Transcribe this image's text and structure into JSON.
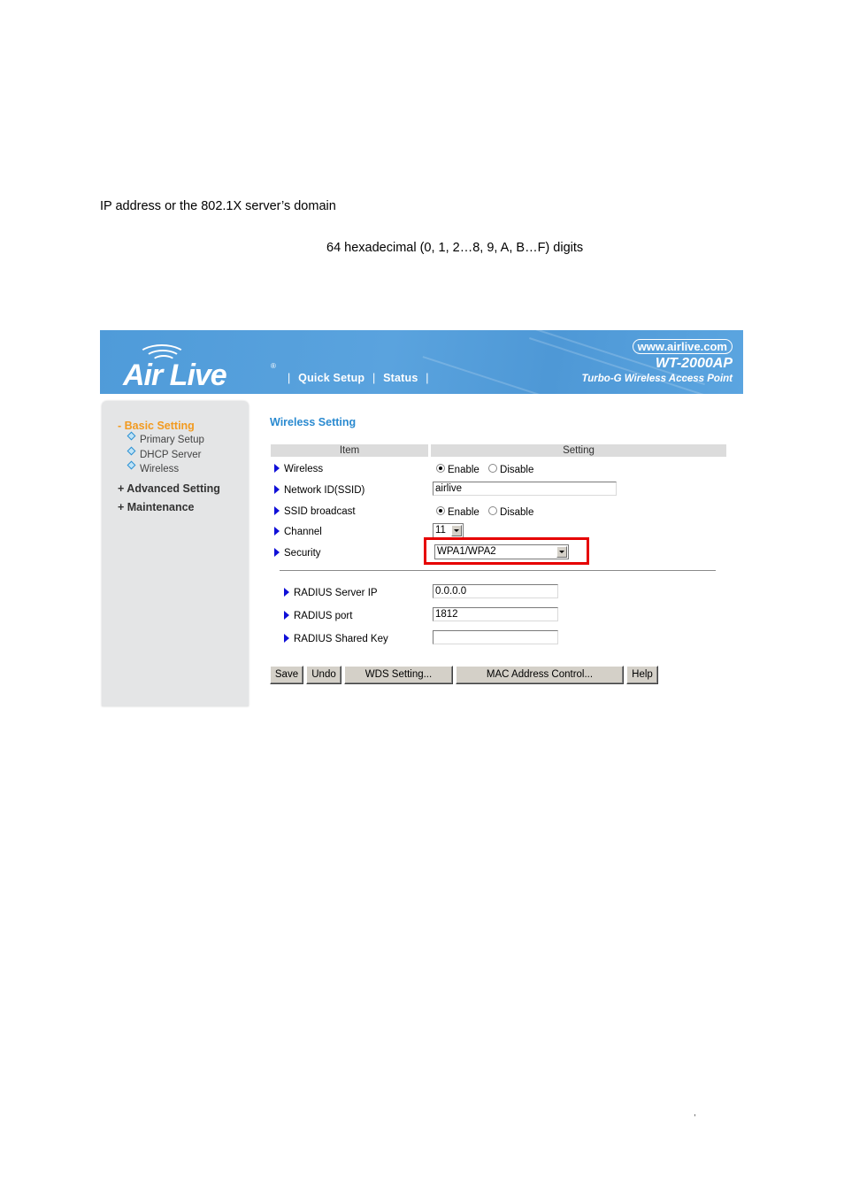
{
  "document": {
    "line1": "IP address or the 802.1X server’s domain",
    "line2": "64 hexadecimal (0, 1, 2…8, 9, A, B…F) digits",
    "stray_mark": ","
  },
  "banner": {
    "logo_text": "Air Live",
    "logo_reg": "®",
    "nav": {
      "sep": "|",
      "quick_setup": "Quick Setup",
      "status": "Status"
    },
    "url": "www.airlive.com",
    "model": "WT-2000AP",
    "tagline": "Turbo-G Wireless Access Point"
  },
  "sidebar": {
    "basic_setting": "- Basic Setting",
    "sub_items": [
      {
        "label": "Primary Setup"
      },
      {
        "label": "DHCP Server"
      },
      {
        "label": "Wireless"
      }
    ],
    "advanced_setting": "+ Advanced Setting",
    "maintenance": "+ Maintenance"
  },
  "content": {
    "title": "Wireless Setting",
    "table_headers": {
      "item": "Item",
      "setting": "Setting"
    },
    "rows": {
      "wireless": {
        "label": "Wireless",
        "options": [
          "Enable",
          "Disable"
        ],
        "selected": "Enable"
      },
      "ssid": {
        "label": "Network ID(SSID)",
        "value": "airlive"
      },
      "ssid_broadcast": {
        "label": "SSID broadcast",
        "options": [
          "Enable",
          "Disable"
        ],
        "selected": "Enable"
      },
      "channel": {
        "label": "Channel",
        "value": "11"
      },
      "security": {
        "label": "Security",
        "value": "WPA1/WPA2"
      }
    },
    "radius": {
      "server_ip": {
        "label": "RADIUS Server IP",
        "value": "0.0.0.0"
      },
      "port": {
        "label": "RADIUS port",
        "value": "1812"
      },
      "shared_key": {
        "label": "RADIUS Shared Key",
        "value": ""
      }
    },
    "buttons": {
      "save": "Save",
      "undo": "Undo",
      "wds": "WDS Setting...",
      "mac": "MAC Address Control...",
      "help": "Help"
    },
    "highlight_color": "#e60000"
  }
}
